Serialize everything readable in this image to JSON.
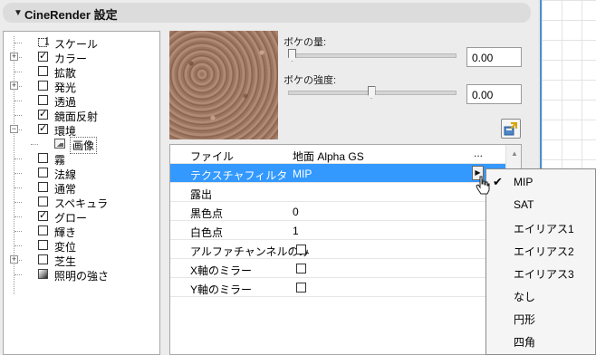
{
  "header": {
    "title": "CineRender 設定"
  },
  "tree": {
    "items": [
      {
        "label": "スケール",
        "checked": false,
        "expandable": false,
        "icon": "scale-icon"
      },
      {
        "label": "カラー",
        "checked": true,
        "expandable": true
      },
      {
        "label": "拡散",
        "checked": false,
        "expandable": false
      },
      {
        "label": "発光",
        "checked": false,
        "expandable": true
      },
      {
        "label": "透過",
        "checked": false,
        "expandable": false
      },
      {
        "label": "鏡面反射",
        "checked": true,
        "expandable": false
      },
      {
        "label": "環境",
        "checked": true,
        "expandable": true,
        "expanded": true
      },
      {
        "label": "画像",
        "child": true,
        "selected": true,
        "icon": "image-icon"
      },
      {
        "label": "霧",
        "checked": false,
        "expandable": false
      },
      {
        "label": "法線",
        "checked": false,
        "expandable": false
      },
      {
        "label": "通常",
        "checked": false,
        "expandable": false
      },
      {
        "label": "スペキュラ",
        "checked": false,
        "expandable": false
      },
      {
        "label": "グロー",
        "checked": true,
        "expandable": false
      },
      {
        "label": "輝き",
        "checked": false,
        "expandable": false
      },
      {
        "label": "変位",
        "checked": false,
        "expandable": false
      },
      {
        "label": "芝生",
        "checked": false,
        "expandable": true
      },
      {
        "label": "照明の強さ",
        "checked": false,
        "expandable": false,
        "icon": "light-icon"
      }
    ]
  },
  "sliders": {
    "bokeh_amount": {
      "label": "ボケの量:",
      "value": "0.00",
      "level": 0.0
    },
    "bokeh_strength": {
      "label": "ボケの強度:",
      "value": "0.00",
      "level": 0.5
    }
  },
  "properties": {
    "rows": [
      {
        "name": "ファイル",
        "value": "地面 Alpha GS",
        "control": "ellipsis",
        "control_text": "..."
      },
      {
        "name": "テクスチャフィルタ",
        "value": "MIP",
        "control": "dropdown",
        "selected": true
      },
      {
        "name": "露出",
        "value": ""
      },
      {
        "name": "黒色点",
        "value": "0"
      },
      {
        "name": "白色点",
        "value": "1"
      },
      {
        "name": "アルファチャンネルのみ",
        "value": "",
        "control": "checkbox",
        "checked": false
      },
      {
        "name": "X軸のミラー",
        "value": "",
        "control": "checkbox",
        "checked": false
      },
      {
        "name": "Y軸のミラー",
        "value": "",
        "control": "checkbox",
        "checked": false
      }
    ]
  },
  "menu": {
    "items": [
      {
        "label": "MIP",
        "checked": true
      },
      {
        "label": "SAT",
        "checked": false
      },
      {
        "label": "エイリアス1",
        "checked": false
      },
      {
        "label": "エイリアス2",
        "checked": false
      },
      {
        "label": "エイリアス3",
        "checked": false
      },
      {
        "label": "なし",
        "checked": false
      },
      {
        "label": "円形",
        "checked": false
      },
      {
        "label": "四角",
        "checked": false
      }
    ]
  },
  "colors": {
    "selection": "#3399ff",
    "canvas_border": "#4b8fd3",
    "texture": "#a07a64"
  },
  "icons": {
    "header_toggle": "triangle-down-icon",
    "export": "export-icon",
    "menu_check": "checkmark-icon"
  }
}
